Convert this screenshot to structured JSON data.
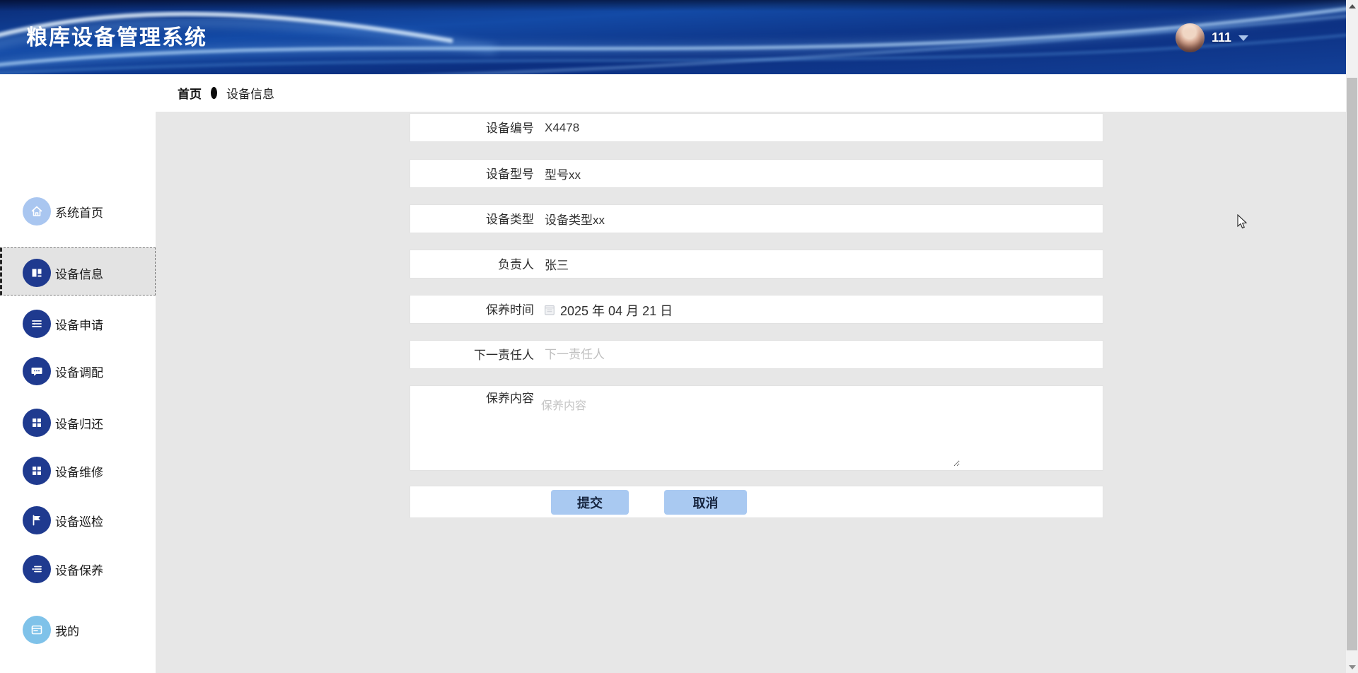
{
  "header": {
    "title": "粮库设备管理系统",
    "user": {
      "name": "111"
    }
  },
  "breadcrumb": {
    "home": "首页",
    "current": "设备信息"
  },
  "sidebar": {
    "items": [
      {
        "label": "系统首页",
        "icon": "home-icon"
      },
      {
        "label": "设备信息",
        "icon": "book-icon",
        "active": true
      },
      {
        "label": "设备申请",
        "icon": "list-arrow-icon"
      },
      {
        "label": "设备调配",
        "icon": "chat-icon"
      },
      {
        "label": "设备归还",
        "icon": "grid-icon"
      },
      {
        "label": "设备维修",
        "icon": "grid-icon"
      },
      {
        "label": "设备巡检",
        "icon": "flag-icon"
      },
      {
        "label": "设备保养",
        "icon": "list-icon"
      },
      {
        "label": "我的",
        "icon": "profile-card-icon"
      }
    ]
  },
  "form": {
    "fields": [
      {
        "label": "设备编号",
        "value": "X4478",
        "type": "text"
      },
      {
        "label": "设备型号",
        "value": "型号xx",
        "type": "text"
      },
      {
        "label": "设备类型",
        "value": "设备类型xx",
        "type": "text"
      },
      {
        "label": "负责人",
        "value": "张三",
        "type": "text"
      },
      {
        "label": "保养时间",
        "value": "2025 年 04 月 21 日",
        "type": "date"
      },
      {
        "label": "下一责任人",
        "value": "",
        "placeholder": "下一责任人",
        "type": "text"
      },
      {
        "label": "保养内容",
        "value": "",
        "placeholder": "保养内容",
        "type": "textarea"
      }
    ],
    "submit_label": "提交",
    "cancel_label": "取消"
  },
  "colors": {
    "header_base": "#0d2f80",
    "sidebar_icon_dark": "#1f3a8f",
    "sidebar_icon_light": "#a9c6f0",
    "sidebar_icon_sky": "#7fc2e9",
    "button_blue": "#a9c9f1",
    "content_bg": "#e7e7e7"
  }
}
